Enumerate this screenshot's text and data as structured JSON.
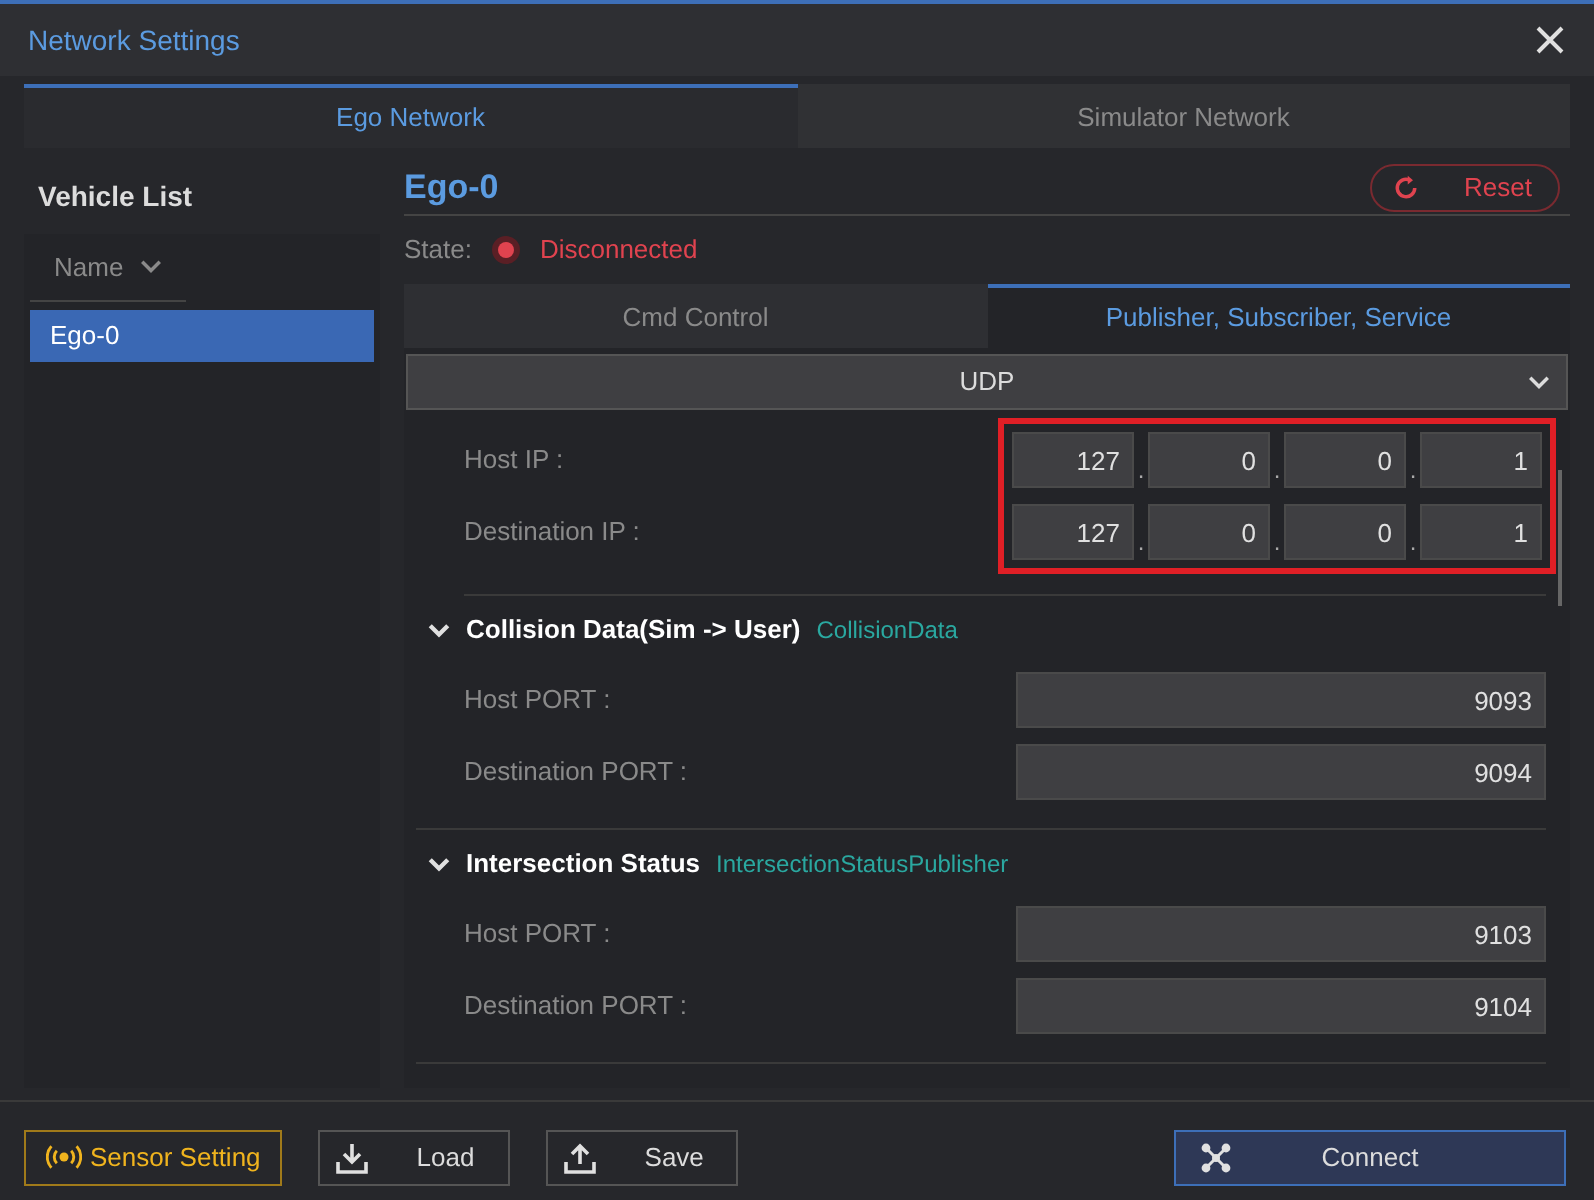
{
  "window": {
    "title": "Network Settings"
  },
  "tabs": [
    {
      "label": "Ego Network",
      "selected": true
    },
    {
      "label": "Simulator Network",
      "selected": false
    }
  ],
  "vehicle_list": {
    "title": "Vehicle List",
    "column": "Name",
    "items": [
      {
        "label": "Ego-0",
        "selected": true
      }
    ]
  },
  "vehicle": {
    "name": "Ego-0",
    "reset": "Reset",
    "state_label": "State:",
    "state": "Disconnected",
    "connected": false
  },
  "sub_tabs": [
    {
      "label": "Cmd Control",
      "selected": false
    },
    {
      "label": "Publisher, Subscriber, Service",
      "selected": true
    }
  ],
  "protocol": "UDP",
  "ip_highlighted": true,
  "ip_fields": [
    {
      "label": "Host IP :",
      "octets": [
        "127",
        "0",
        "0",
        "1"
      ],
      "separators": [
        ".",
        ".",
        "."
      ]
    },
    {
      "label": "Destination IP :",
      "octets": [
        "127",
        "0",
        "0",
        "1"
      ],
      "separators": [
        ".",
        ".",
        "."
      ]
    }
  ],
  "sections": [
    {
      "title": "Collision Data(Sim -> User)",
      "topic": "CollisionData",
      "expanded": true,
      "ports": [
        {
          "label": "Host PORT :",
          "value": "9093"
        },
        {
          "label": "Destination PORT :",
          "value": "9094"
        }
      ]
    },
    {
      "title": "Intersection Status",
      "topic": "IntersectionStatusPublisher",
      "expanded": true,
      "ports": [
        {
          "label": "Host PORT :",
          "value": "9103"
        },
        {
          "label": "Destination PORT :",
          "value": "9104"
        }
      ]
    }
  ],
  "footer": {
    "sensor": "Sensor Setting",
    "load": "Load",
    "save": "Save",
    "connect": "Connect"
  }
}
